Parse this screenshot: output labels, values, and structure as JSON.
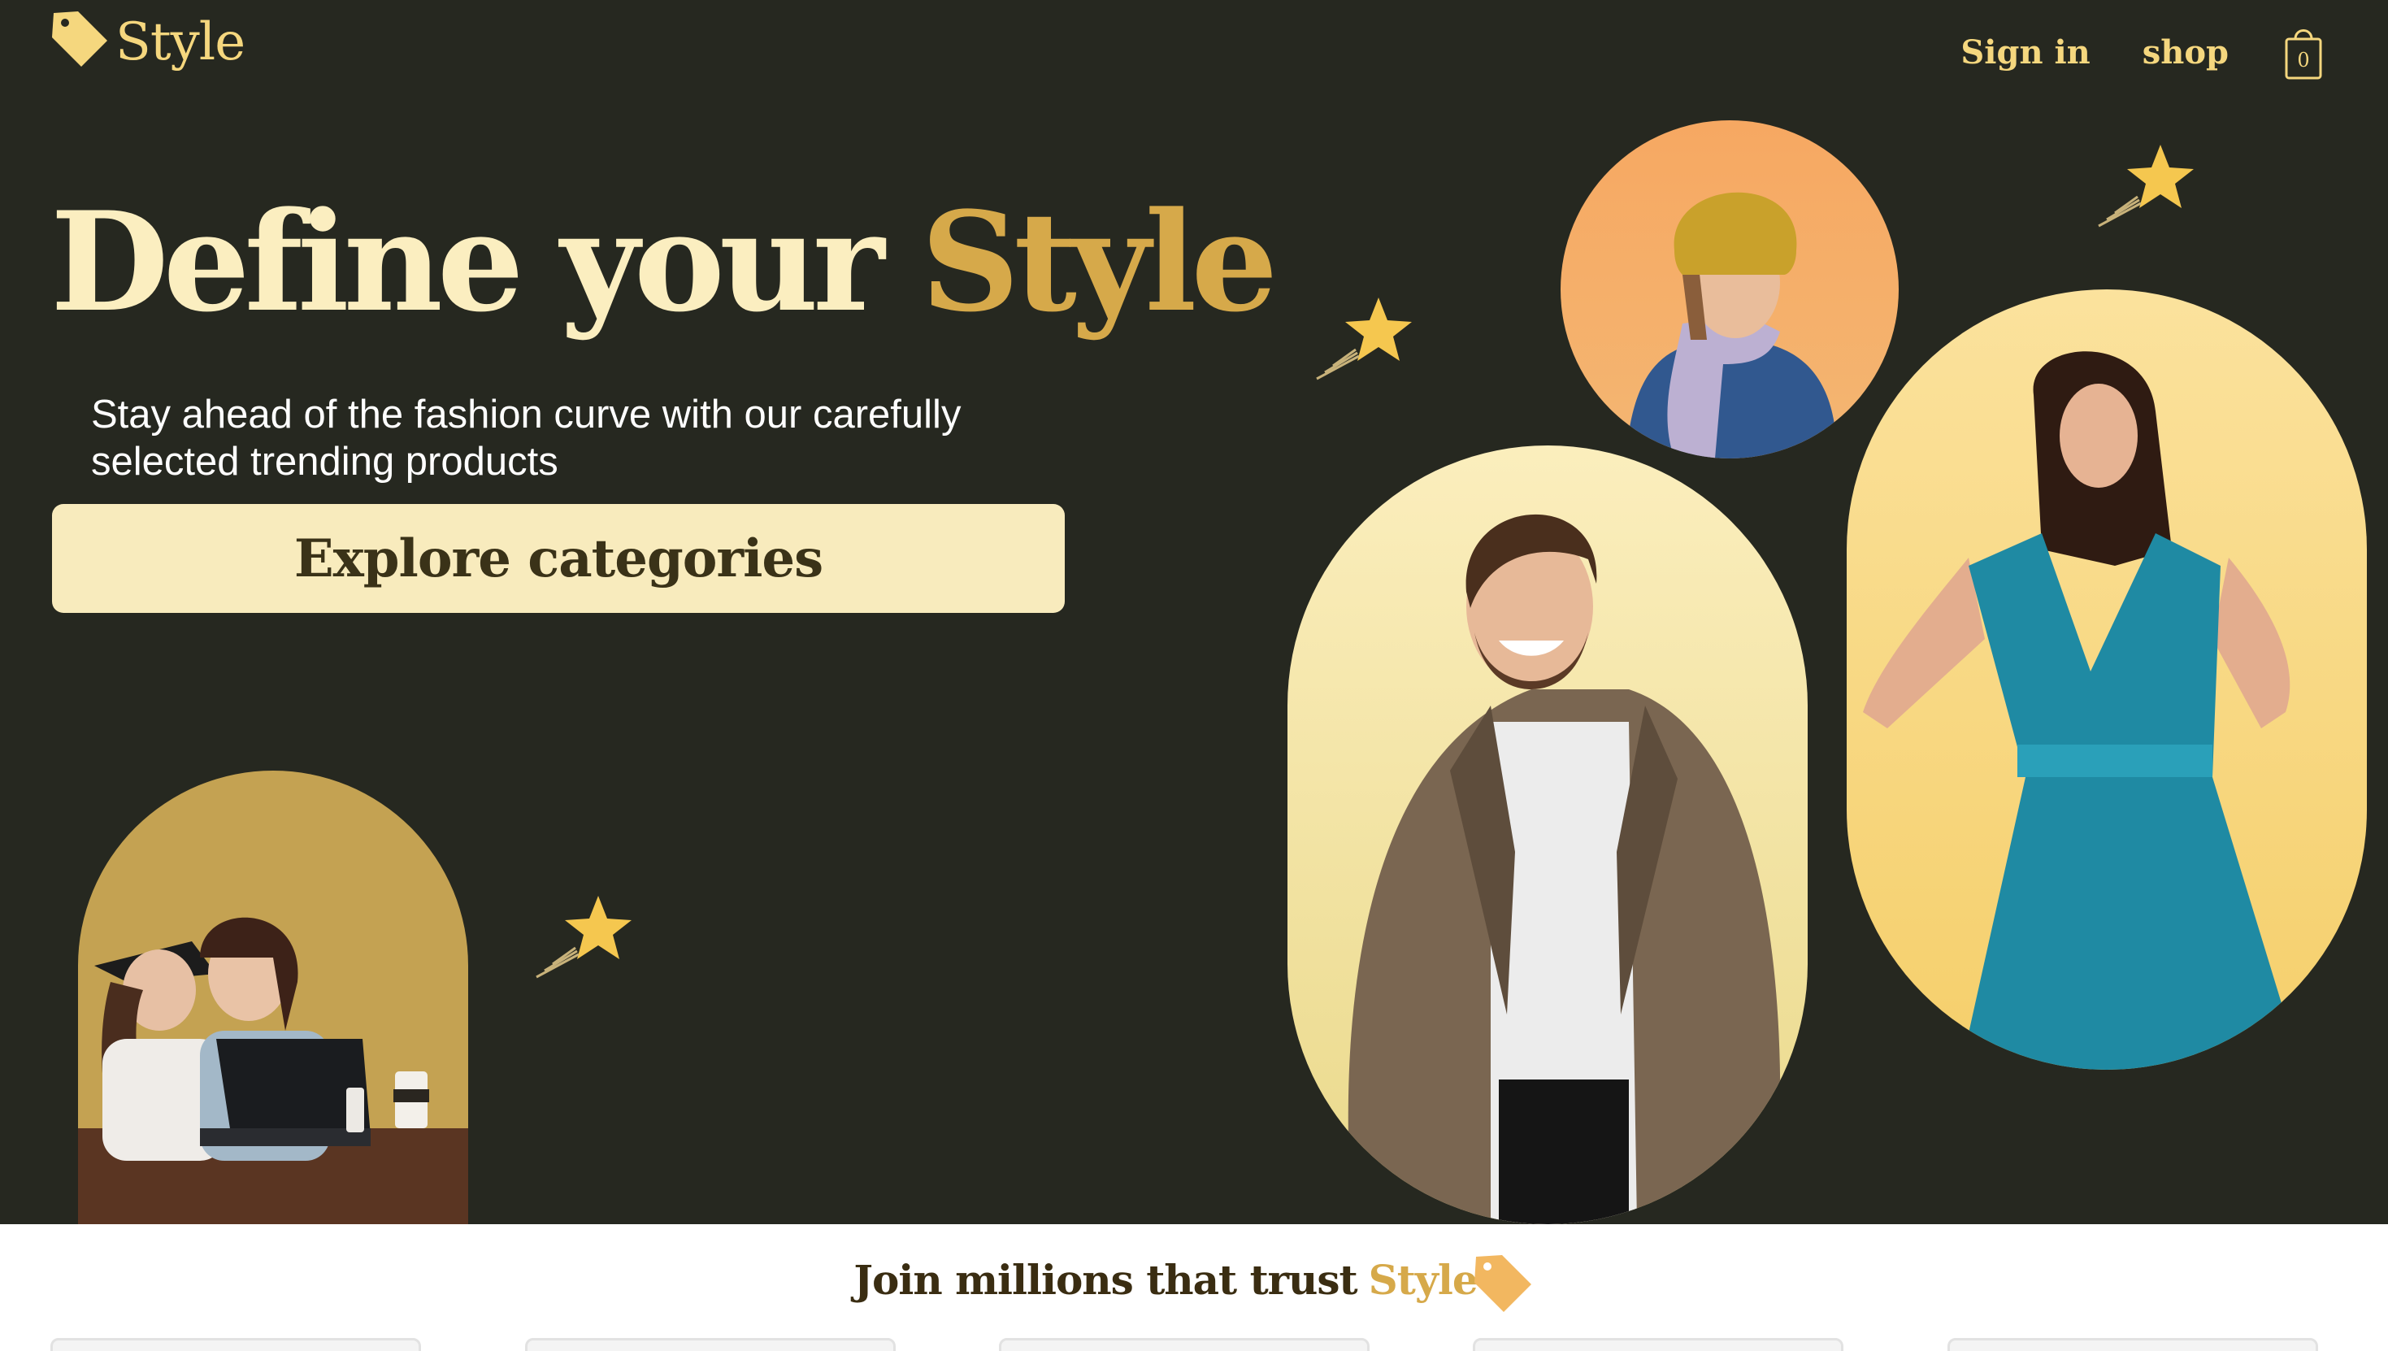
{
  "header": {
    "logo_text": "Style",
    "logo_icon": "price-tag-icon",
    "nav": [
      {
        "label": "Sign in"
      },
      {
        "label": "shop"
      }
    ],
    "cart_icon": "shopping-bag-icon",
    "cart_count": "0"
  },
  "hero": {
    "headline_main": "Define your ",
    "headline_accent": "Style",
    "subtext": "Stay ahead of the fashion curve with our carefully selected trending products",
    "cta_label": "Explore categories"
  },
  "trust": {
    "title_main": "Join millions that trust",
    "title_accent": "Style"
  },
  "colors": {
    "background": "#262820",
    "accent_gold": "#d6a94a",
    "cream": "#fbeec0",
    "button_bg": "#f8ebbd"
  }
}
